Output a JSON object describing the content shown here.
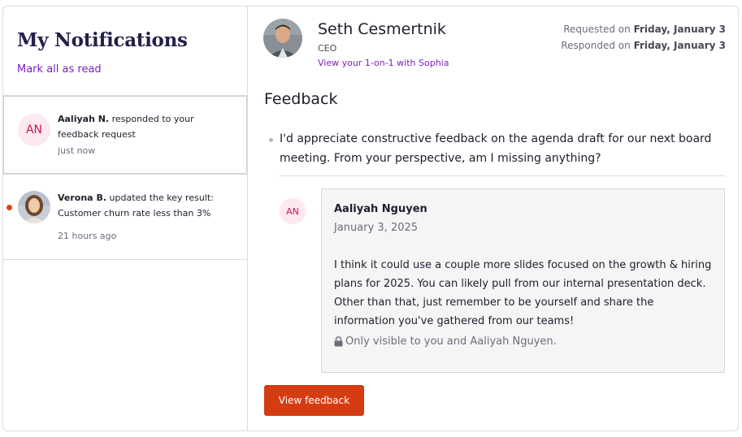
{
  "sidebar": {
    "title": "My Notifications",
    "mark_all_read": "Mark all as read",
    "notifications": [
      {
        "avatar_initials": "AN",
        "actor": "Aaliyah N.",
        "message": " responded to your feedback request",
        "time": "just now",
        "unread": false
      },
      {
        "avatar_initials": "",
        "actor": "Verona B.",
        "message": " updated the key result: Customer churn rate less than 3%",
        "time": "21 hours ago",
        "unread": true
      }
    ]
  },
  "detail": {
    "sender": {
      "name": "Seth Cesmertnik",
      "role": "CEO",
      "one_on_one_link": "View your 1-on-1 with Sophia"
    },
    "requested_prefix": "Requested on ",
    "requested_date": "Friday, January 3",
    "responded_prefix": "Responded on ",
    "responded_date": "Friday, January 3",
    "section_title": "Feedback",
    "question": "I'd appreciate constructive feedback on the agenda draft for our next board meeting. From your perspective, am I missing anything?",
    "response": {
      "avatar_initials": "AN",
      "author": "Aaliyah Nguyen",
      "date": "January 3, 2025",
      "body": "I think it could use a couple more slides focused on the growth & hiring plans for 2025. You can likely pull from our internal presentation deck. Other than that, just remember to be yourself and share the information you've gathered from our teams!",
      "privacy_note": "Only visible to you and Aaliyah Nguyen."
    },
    "view_button": "View feedback"
  },
  "colors": {
    "accent_purple": "#7b1fc1",
    "button_orange": "#d63c12",
    "unread_dot": "#d9451a",
    "initials_bg": "#fde8ef"
  },
  "icons": [
    "lock-icon"
  ]
}
